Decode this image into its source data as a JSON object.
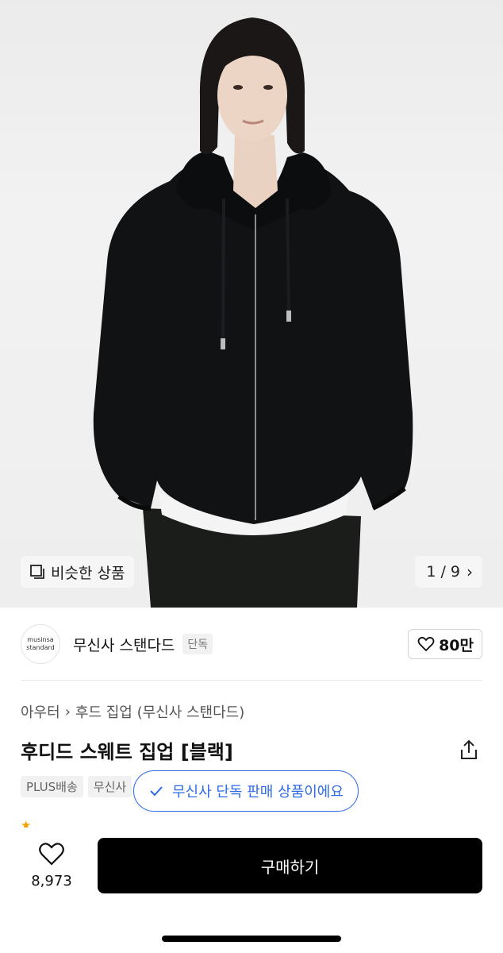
{
  "hero": {
    "similar_button": "비슷한 상품",
    "counter": "1 / 9"
  },
  "brand": {
    "logo_line1": "musinsa",
    "logo_line2": "standard",
    "name": "무신사 스탠다드",
    "tag": "단독",
    "like_count": "80만"
  },
  "breadcrumb": {
    "category": "아우터",
    "subcategory": "후드 집업 (무신사 스탠다드)"
  },
  "product": {
    "title": "후디드 스웨트 집업 [블랙]",
    "tags": [
      "PLUS배송",
      "무신사"
    ]
  },
  "toast": {
    "message": "무신사 단독 판매 상품이에요"
  },
  "bottom": {
    "wish_count": "8,973",
    "buy_label": "구매하기"
  },
  "colors": {
    "accent_blue": "#2f6be8",
    "buy_button": "#000000"
  }
}
